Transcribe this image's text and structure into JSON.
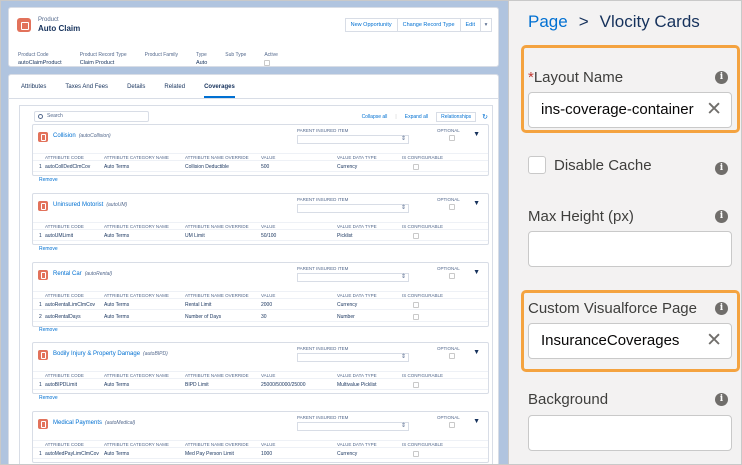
{
  "record": {
    "type": "Product",
    "name": "Auto Claim",
    "buttons": [
      "New Opportunity",
      "Change Record Type",
      "Edit"
    ],
    "fields": [
      {
        "label": "Product Code",
        "value": "autoClaimProduct"
      },
      {
        "label": "Product Record Type",
        "value": "Claim Product"
      },
      {
        "label": "Product Family",
        "value": ""
      },
      {
        "label": "Type",
        "value": "Auto"
      },
      {
        "label": "Sub Type",
        "value": ""
      },
      {
        "label": "Active",
        "value": ""
      }
    ]
  },
  "tabs": [
    "Attributes",
    "Taxes And Fees",
    "Details",
    "Related",
    "Coverages"
  ],
  "active_tab": "Coverages",
  "toolbar": {
    "search_placeholder": "Search",
    "collapse_all": "Collapse all",
    "separator": "|",
    "expand_all": "Expand all",
    "relationships": "Relationships"
  },
  "table_headers": {
    "attr_code": "ATTRIBUTE CODE",
    "attr_category": "ATTRIBUTE CATEGORY NAME",
    "attr_override": "ATTRIBUTE NAME OVERRIDE",
    "value": "VALUE",
    "value_type": "VALUE DATA TYPE",
    "configurable": "IS CONFIGURABLE"
  },
  "pii_label": "PARENT INSURED ITEM",
  "optional_label": "OPTIONAL",
  "remove_label": "Remove",
  "coverages": [
    {
      "title": "Collision",
      "code": "(autoCollision)",
      "rows": [
        {
          "n": "1",
          "code": "autoCollDedClmCov",
          "cat": "Auto Terms",
          "name": "Collision Deductible",
          "value": "500",
          "type": "Currency"
        }
      ]
    },
    {
      "title": "Uninsured Motorist",
      "code": "(autoUM)",
      "rows": [
        {
          "n": "1",
          "code": "autoUMLimit",
          "cat": "Auto Terms",
          "name": "UM Limit",
          "value": "50/100",
          "type": "Picklist"
        }
      ]
    },
    {
      "title": "Rental Car",
      "code": "(autoRental)",
      "rows": [
        {
          "n": "1",
          "code": "autoRentalLimClmCov",
          "cat": "Auto Terms",
          "name": "Rental Limit",
          "value": "2000",
          "type": "Currency"
        },
        {
          "n": "2",
          "code": "autoRentalDays",
          "cat": "Auto Terms",
          "name": "Number of Days",
          "value": "30",
          "type": "Number"
        }
      ]
    },
    {
      "title": "Bodily Injury & Property Damage",
      "code": "(autoBIPD)",
      "rows": [
        {
          "n": "1",
          "code": "autoBIPDLimit",
          "cat": "Auto Terms",
          "name": "BIPD Limit",
          "value": "25000/50000/25000",
          "type": "Multivalue Picklist"
        }
      ]
    },
    {
      "title": "Medical Payments",
      "code": "(autoMedical)",
      "rows": [
        {
          "n": "1",
          "code": "autoMedPayLimClmCov",
          "cat": "Auto Terms",
          "name": "Med Pay Person Limit",
          "value": "1000",
          "type": "Currency"
        }
      ]
    }
  ],
  "panel": {
    "breadcrumb_root": "Page",
    "breadcrumb_sep": ">",
    "breadcrumb_current": "Vlocity Cards",
    "layout_name_label": "Layout Name",
    "layout_name_value": "ins-coverage-container",
    "disable_cache_label": "Disable Cache",
    "max_height_label": "Max Height (px)",
    "max_height_value": "",
    "vf_page_label": "Custom Visualforce Page",
    "vf_page_value": "InsuranceCoverages",
    "background_label": "Background",
    "background_value": ""
  },
  "colors": {
    "accent": "#0070d2",
    "highlight": "#f4a340",
    "required": "#c23934"
  }
}
